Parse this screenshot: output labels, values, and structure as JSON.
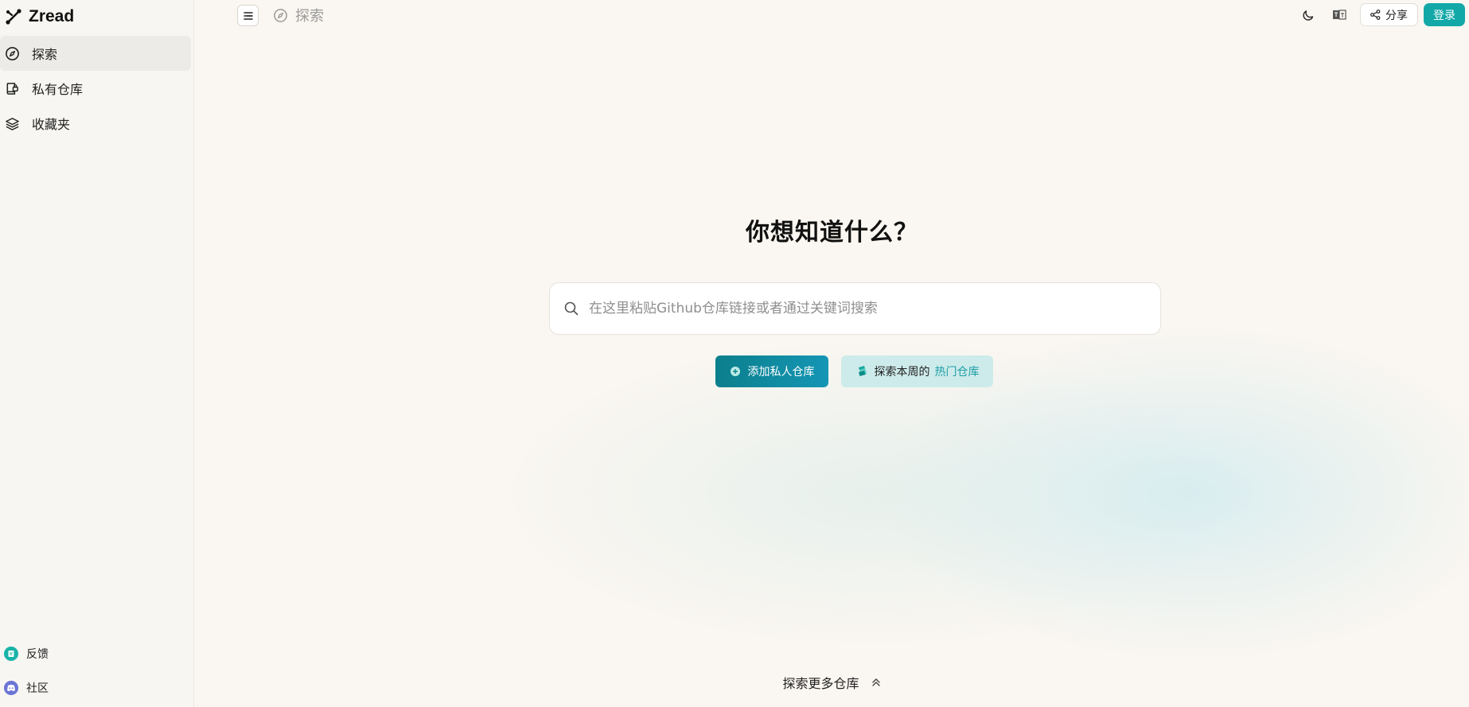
{
  "app": {
    "name": "Zread"
  },
  "sidebar": {
    "items": [
      {
        "label": "探索",
        "icon": "compass-icon",
        "active": true
      },
      {
        "label": "私有仓库",
        "icon": "private-repo-icon",
        "active": false
      },
      {
        "label": "收藏夹",
        "icon": "layers-icon",
        "active": false
      }
    ],
    "footer": [
      {
        "label": "反馈",
        "icon": "feedback-icon",
        "color": "#19b3a8"
      },
      {
        "label": "社区",
        "icon": "discord-icon",
        "color": "#6b74d6"
      }
    ]
  },
  "topbar": {
    "breadcrumb": "探索",
    "share_label": "分享",
    "login_label": "登录"
  },
  "main": {
    "title": "你想知道什么？",
    "search_placeholder": "在这里粘贴Github仓库链接或者通过关键词搜索",
    "add_repo_label": "添加私人仓库",
    "trending_prefix": "探索本周的",
    "trending_highlight": "热门仓库",
    "explore_more_label": "探索更多仓库"
  },
  "colors": {
    "accent": "#13a8a8",
    "highlight": "#1b9ea6"
  }
}
